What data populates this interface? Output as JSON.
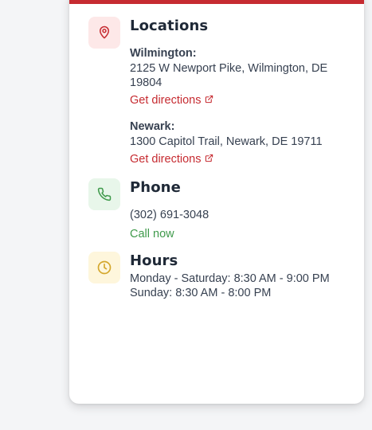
{
  "locations": {
    "title": "Locations",
    "icon": "map-pin-icon",
    "items": [
      {
        "name": "Wilmington:",
        "address": "2125 W Newport Pike, Wilmington, DE 19804",
        "link_label": "Get directions"
      },
      {
        "name": "Newark:",
        "address": "1300 Capitol Trail, Newark, DE 19711",
        "link_label": "Get directions"
      }
    ]
  },
  "phone": {
    "title": "Phone",
    "icon": "phone-icon",
    "number": "(302) 691-3048",
    "call_label": "Call now"
  },
  "hours": {
    "title": "Hours",
    "icon": "clock-icon",
    "lines": [
      "Monday - Saturday: 8:30 AM - 9:00 PM",
      "Sunday: 8:30 AM - 8:00 PM"
    ]
  },
  "colors": {
    "accent": "#c62b31",
    "success": "#3f9a4b",
    "warning": "#d4a72c"
  }
}
